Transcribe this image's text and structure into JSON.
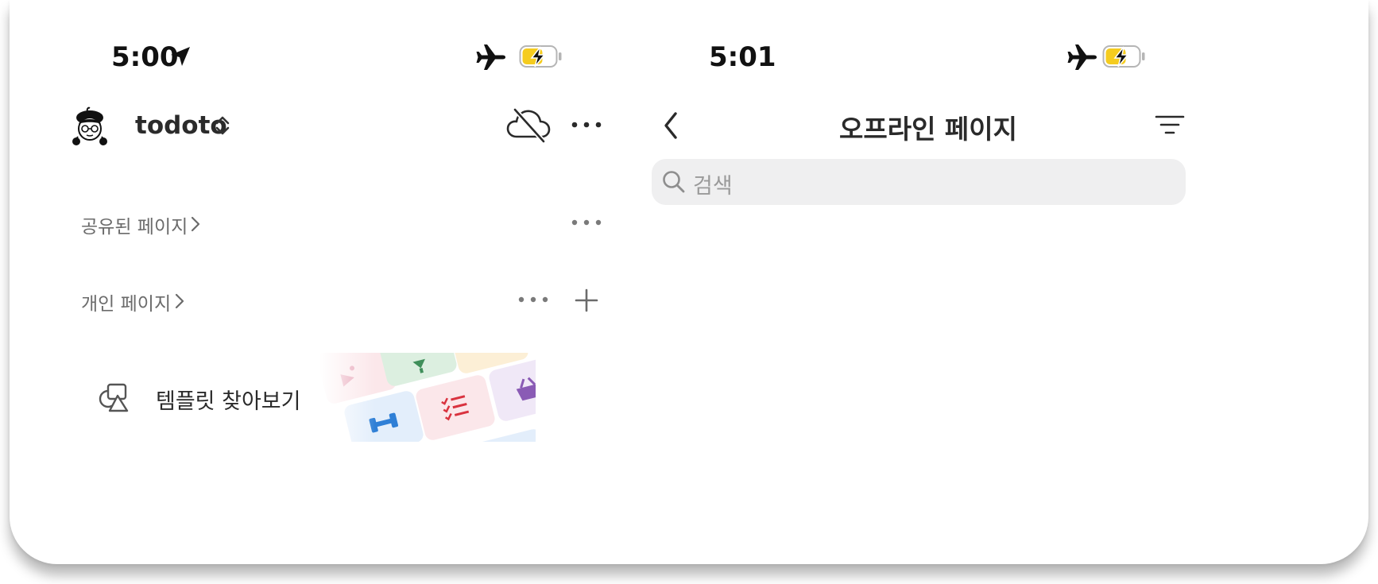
{
  "left_screen": {
    "status_bar": {
      "time": "5:00",
      "location_icon": "location-arrow-icon",
      "airplane_icon": "airplane-icon",
      "battery_icon": "battery-charging-icon"
    },
    "header": {
      "avatar_icon": "avatar",
      "workspace_name": "todoto",
      "switcher_icon": "chevron-up-down-icon",
      "offline_icon": "cloud-off-icon",
      "more_icon": "more-icon"
    },
    "sections": [
      {
        "label": "공유된 페이지",
        "chevron_icon": "chevron-right-icon",
        "more_icon": "more-icon"
      },
      {
        "label": "개인 페이지",
        "chevron_icon": "chevron-right-icon",
        "more_icon": "more-icon",
        "add_icon": "plus-icon"
      }
    ],
    "templates": {
      "label": "템플릿 찾아보기",
      "icon": "shapes-icon",
      "colors": {
        "pink": "#fbe7ea",
        "green": "#dcefe0",
        "yellow": "#fcefd6",
        "blue": "#e3eefb",
        "purple": "#f0e8f7",
        "red_icon": "#d9333f",
        "blue_icon": "#2f7fd6",
        "purple_icon": "#8a5bb5",
        "green_icon": "#3f8f5a",
        "pink_icon": "#e59bb0"
      }
    }
  },
  "right_screen": {
    "status_bar": {
      "time": "5:01",
      "airplane_icon": "airplane-icon",
      "battery_icon": "battery-charging-icon"
    },
    "header": {
      "back_icon": "chevron-left-icon",
      "title": "오프라인 페이지",
      "sort_icon": "filter-lines-icon"
    },
    "search": {
      "placeholder": "검색",
      "icon": "search-icon"
    }
  },
  "colors": {
    "battery_fill": "#f5cc1f",
    "icon_gray": "#7a7a7a",
    "search_bg": "#efeff0"
  }
}
